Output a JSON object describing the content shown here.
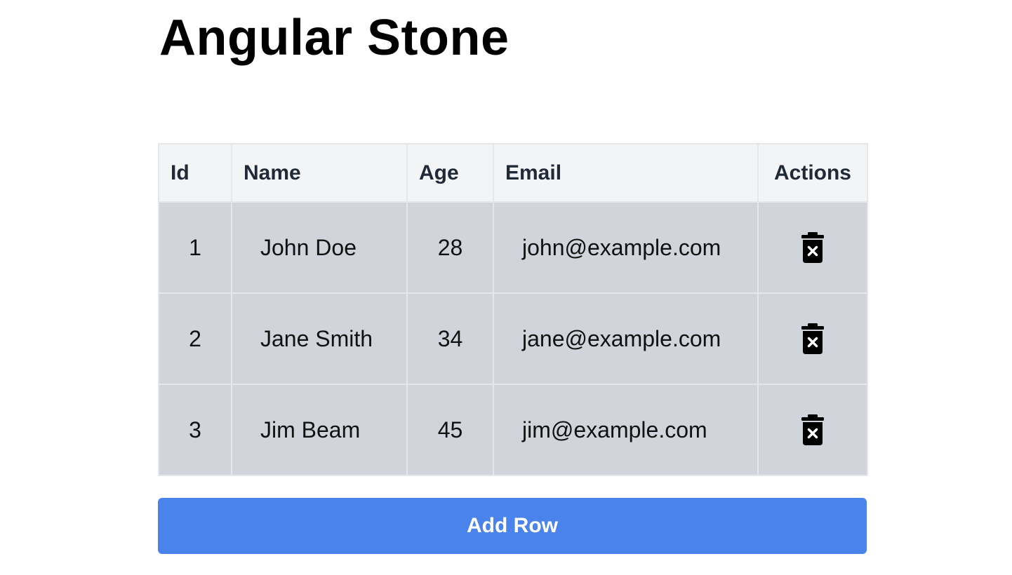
{
  "page": {
    "title": "Angular Stone"
  },
  "table": {
    "headers": {
      "id": "Id",
      "name": "Name",
      "age": "Age",
      "email": "Email",
      "actions": "Actions"
    },
    "rows": [
      {
        "id": "1",
        "name": "John Doe",
        "age": "28",
        "email": "john@example.com",
        "action_icon": "trash-delete-icon"
      },
      {
        "id": "2",
        "name": "Jane Smith",
        "age": "34",
        "email": "jane@example.com",
        "action_icon": "trash-delete-icon"
      },
      {
        "id": "3",
        "name": "Jim Beam",
        "age": "45",
        "email": "jim@example.com",
        "action_icon": "trash-delete-icon"
      }
    ]
  },
  "actions": {
    "add_row_label": "Add Row"
  },
  "colors": {
    "header_bg": "#f3f4f6",
    "row_bg": "#d1d5db",
    "border": "#e5e7eb",
    "button_bg": "#4a83ec",
    "button_text": "#ffffff"
  }
}
